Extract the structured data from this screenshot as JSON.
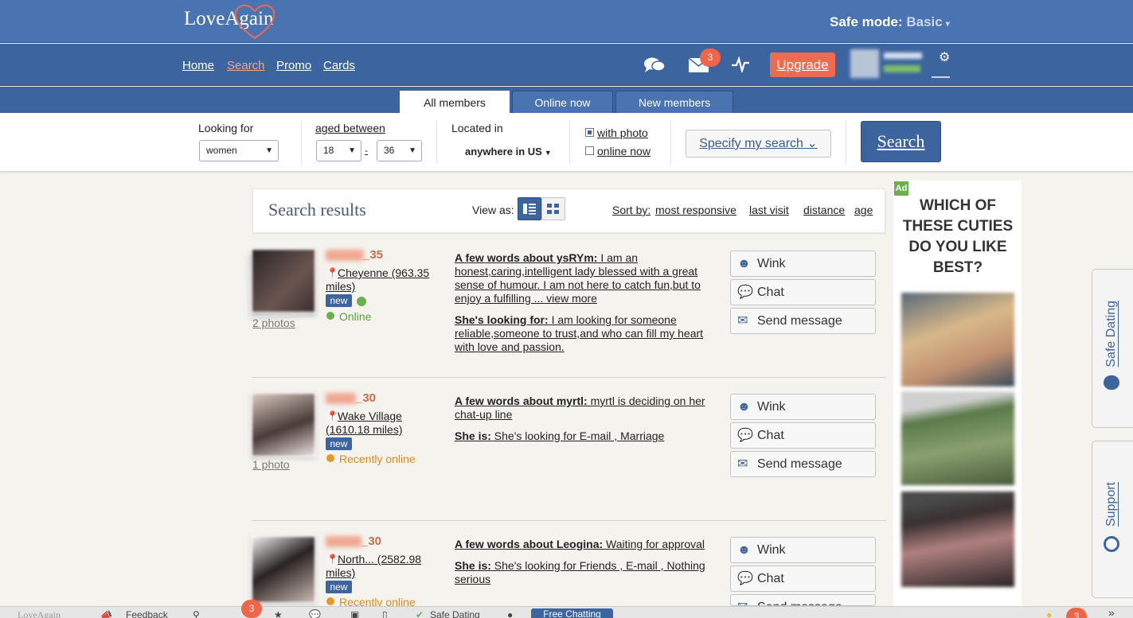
{
  "app": {
    "logo": "LoveAgain"
  },
  "header": {
    "safe_label": "Safe mode:",
    "safe_value": "Basic",
    "mail_count": "3",
    "upgrade_label": "Upgrade"
  },
  "nav": {
    "items": [
      "Home",
      "Search",
      "Promo",
      "Cards"
    ],
    "active": "Search"
  },
  "tabs": [
    "All members",
    "Online now",
    "New members"
  ],
  "filter": {
    "looking_for_label": "Looking for",
    "looking_for_value": "women",
    "aged_label": "aged between",
    "age_from": "18",
    "age_sep": "-",
    "age_to": "36",
    "located_label": "Located in",
    "located_value": "anywhere in US",
    "with_photo": "with photo",
    "online_now": "online now",
    "specify": "Specify my search",
    "search_button": "Search"
  },
  "results": {
    "title": "Search results",
    "view_as": "View as:",
    "sort_label": "Sort by:",
    "sort_options": [
      "most responsive",
      "last visit",
      "distance",
      "age"
    ],
    "items": [
      {
        "age": "_35",
        "location": "Cheyenne (963.35 miles)",
        "badge": "new",
        "status": "Online",
        "photos": "2 photos",
        "about_label": "A few words about ysRYm:",
        "about_text": "I am an honest,caring,intelligent lady blessed with a great sense of humour. I am not here to catch fun,but to enjoy a fulfilling ... view more",
        "second_label": "She's looking for:",
        "second_text": "I am looking for someone reliable,someone to trust,and who can fill my heart with love and passion."
      },
      {
        "age": "_30",
        "location": "Wake Village (1610.18 miles)",
        "badge": "new",
        "status": "Recently online",
        "photos": "1 photo",
        "about_label": "A few words about myrtl:",
        "about_text": "myrtl is deciding on her chat-up line",
        "second_label": "She is:",
        "second_text": "She's looking for E-mail , Marriage"
      },
      {
        "age": "_30",
        "location": "North... (2582.98 miles)",
        "badge": "new",
        "status": "Recently online",
        "photos": "",
        "about_label": "A few words about Leogina:",
        "about_text": "Waiting for approval",
        "second_label": "She is:",
        "second_text": "She's looking for Friends , E-mail , Nothing serious"
      }
    ],
    "actions": [
      "Wink",
      "Chat",
      "Send message"
    ]
  },
  "ad": {
    "tag": "Ad",
    "title": "WHICH OF THESE CUTIES DO YOU LIKE BEST?"
  },
  "side": {
    "safe": "Safe Dating",
    "support": "Support"
  },
  "bottom": {
    "logo": "LoveAgain",
    "feedback": "Feedback",
    "badge": "3",
    "safe": "Safe Dating",
    "free_chat": "Free Chatting",
    "right_badge": "3",
    "expand": "»"
  },
  "colors": {
    "brand_blue": "#4a73b1",
    "nav_blue": "#3c649f",
    "accent": "#ef6a50",
    "online": "#6ab04c",
    "recent": "#e39a2a"
  }
}
